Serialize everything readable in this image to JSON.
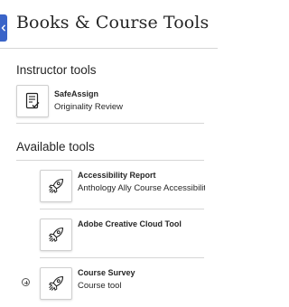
{
  "header": {
    "title": "Books & Course Tools"
  },
  "instructor_tools": {
    "heading": "Instructor tools",
    "items": [
      {
        "name": "SafeAssign",
        "subtitle": "Originality Review",
        "icon": "document-check-icon"
      }
    ]
  },
  "available_tools": {
    "heading": "Available tools",
    "items": [
      {
        "name": "Accessibility Report",
        "subtitle": "Anthology Ally Course Accessibilit...",
        "icon": "rocket-icon"
      },
      {
        "name": "Adobe Creative Cloud Tool",
        "subtitle": "",
        "icon": "rocket-icon"
      },
      {
        "name": "Course Survey",
        "subtitle": "Course tool",
        "icon": "rocket-icon",
        "has_add_icon": true
      }
    ]
  },
  "colors": {
    "accent": "#3a64c8",
    "text": "#262626",
    "divider": "#d6d6d6"
  }
}
